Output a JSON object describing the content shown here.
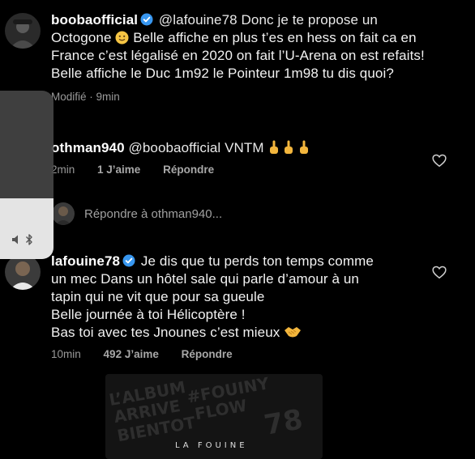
{
  "comments": [
    {
      "username": "boobaofficial",
      "lines": [
        "@lafouine78 Donc je te propose un",
        "Octogone",
        "Belle affiche en plus t’es en hess on fait ca en",
        "France c’est légalisé en 2020 on fait l’U-Arena on est refaits!",
        "Belle affiche le Duc 1m92 le Pointeur 1m98 tu dis quoi?"
      ],
      "time": "Modifié · 9min"
    },
    {
      "username": "othman940",
      "text": "@boobaofficial VNTM",
      "time": "2min",
      "likes": "1 J’aime",
      "reply": "Répondre"
    },
    {
      "username": "lafouine78",
      "lines": [
        "Je dis que tu perds ton temps comme",
        "un mec Dans un hôtel sale qui parle d’amour à un",
        "tapin qui ne vit que pour sa gueule",
        "Belle journée à toi Hélicoptère !",
        "Bas toi avec tes Jnounes c’est mieux"
      ],
      "time": "10min",
      "likes": "492 J’aime",
      "reply": "Répondre"
    }
  ],
  "reply_placeholder": "Répondre à othman940...",
  "volume": {
    "level": 0.36
  },
  "album": {
    "stamps": [
      "L’ALBUM",
      "ARRIVE",
      "BIENTOT",
      "#FOUINY",
      "FLOW",
      "78"
    ],
    "brand": "LA FOUINE"
  },
  "icons": {
    "verified": "verified-badge-icon",
    "heart": "heart-outline-icon",
    "slightly_smiling": "slightly-smiling-face-emoji",
    "middle_finger": "middle-finger-emoji",
    "handshake": "handshake-emoji",
    "speaker": "speaker-icon",
    "bluetooth": "bluetooth-icon"
  },
  "colors": {
    "background": "#000000",
    "verified_blue": "#3897f0",
    "meta_gray": "#9a9a9a"
  }
}
